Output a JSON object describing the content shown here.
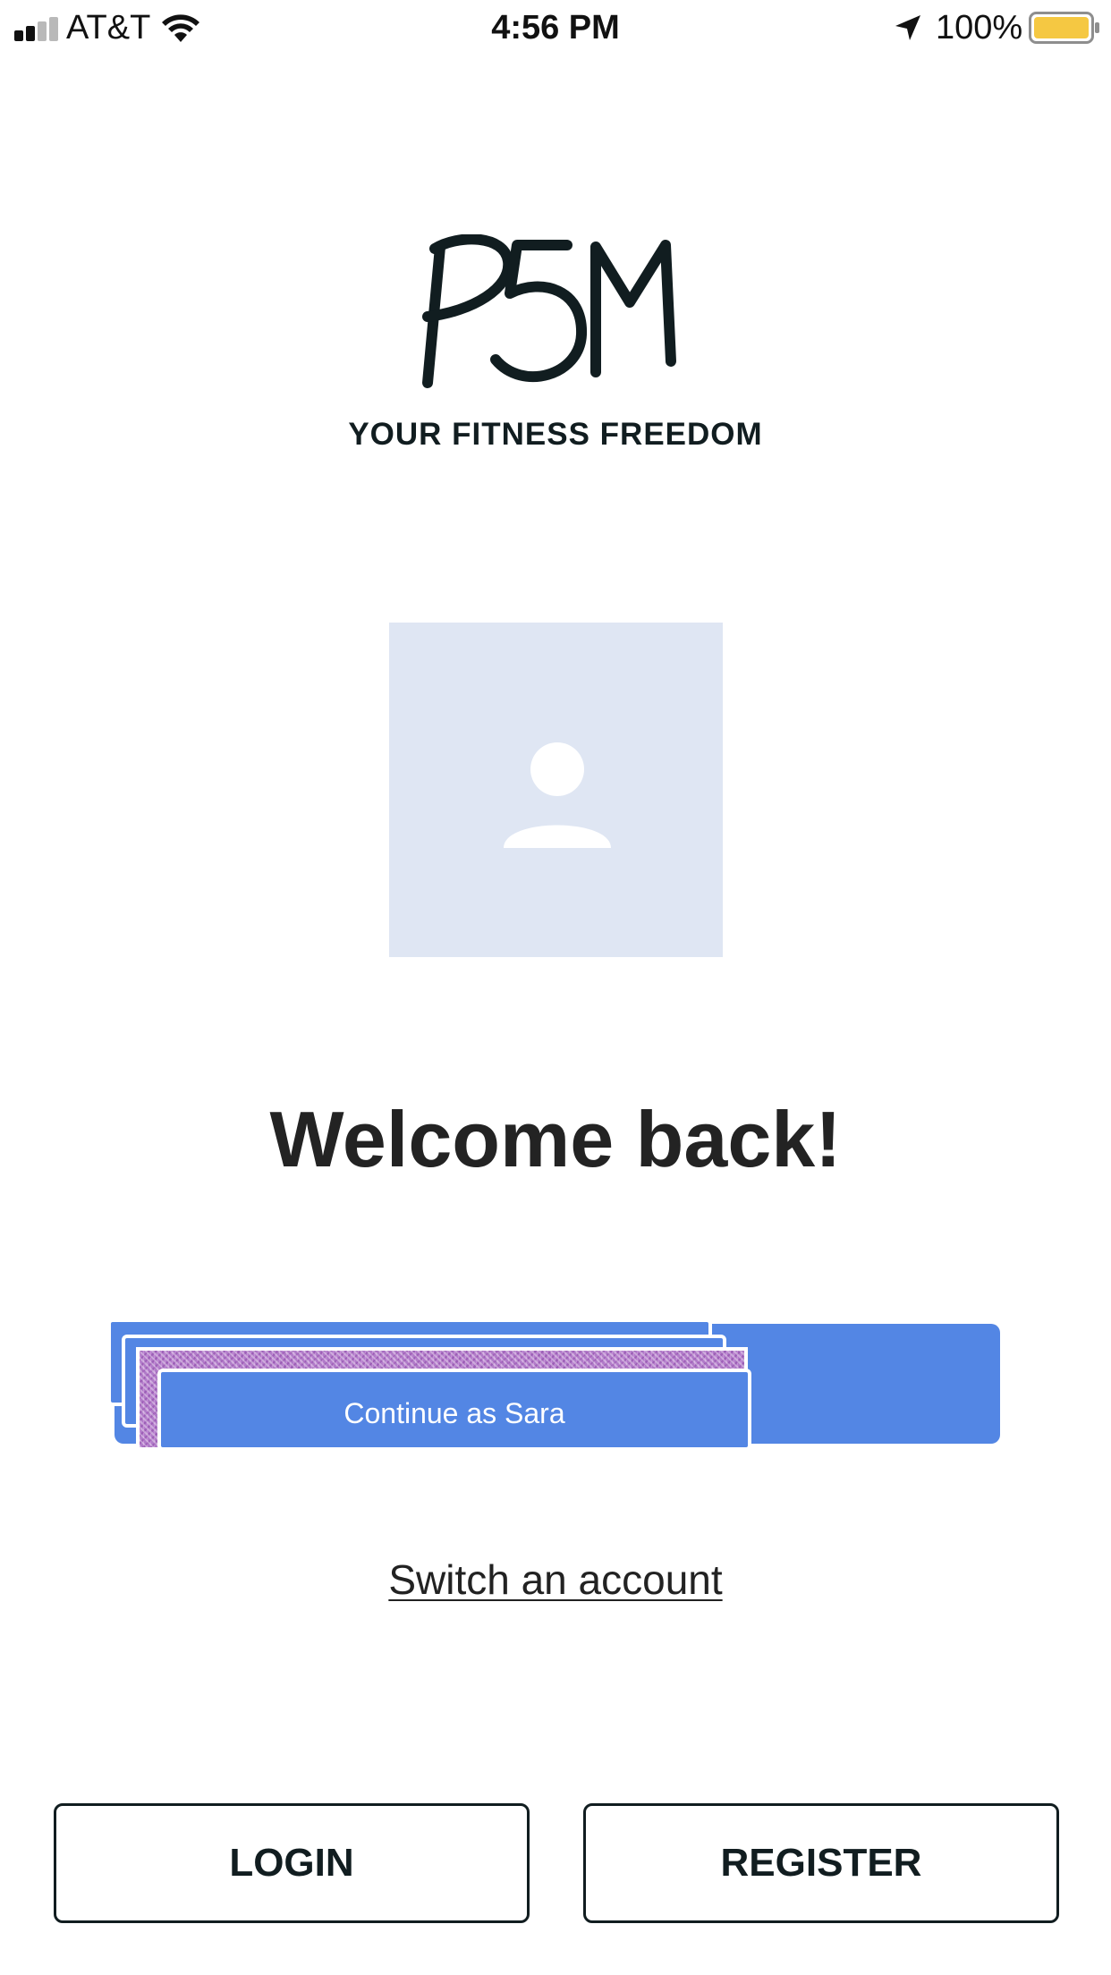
{
  "status_bar": {
    "carrier": "AT&T",
    "time": "4:56 PM",
    "battery_percent": "100%",
    "battery_level": 1.0,
    "signal_bars_filled": 2,
    "signal_bars_total": 4,
    "icons": [
      "signal-icon",
      "wifi-icon",
      "location-arrow-icon",
      "battery-icon"
    ]
  },
  "brand": {
    "logo_text": "P5M",
    "tagline": "YOUR FITNESS FREEDOM",
    "color": "#111d20"
  },
  "avatar": {
    "icon": "user-placeholder-icon",
    "background": "#dfe6f3"
  },
  "welcome": {
    "title": "Welcome back!"
  },
  "continue": {
    "label": "Continue as Sara",
    "color": "#5386e4"
  },
  "switch_account": {
    "label": "Switch an account"
  },
  "actions": {
    "login_label": "LOGIN",
    "register_label": "REGISTER"
  }
}
